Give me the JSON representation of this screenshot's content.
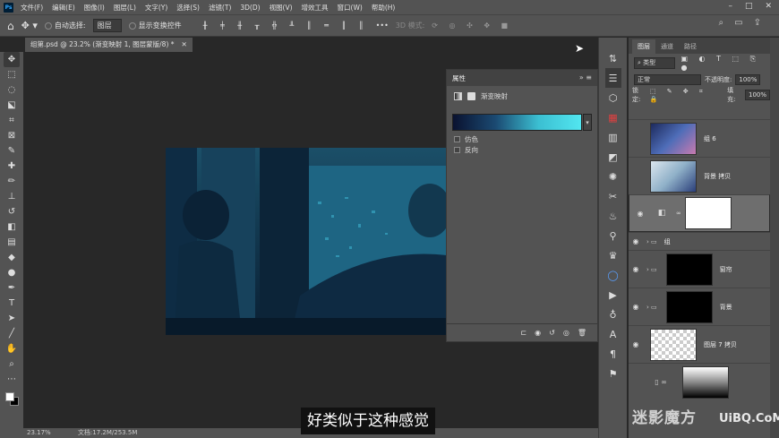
{
  "app": {
    "icon_label": "Ps"
  },
  "menu": [
    "文件(F)",
    "编辑(E)",
    "图像(I)",
    "图层(L)",
    "文字(Y)",
    "选择(S)",
    "滤镜(T)",
    "3D(D)",
    "视图(V)",
    "增效工具",
    "窗口(W)",
    "帮助(H)"
  ],
  "options": {
    "auto_select_label": "自动选择:",
    "auto_select_value": "图层",
    "show_transform_label": "显示变换控件",
    "mode_3d_label": "3D 模式:"
  },
  "document_tab": {
    "title": "组第.psd @ 23.2% (渐变映射 1, 图层蒙版/8) *"
  },
  "status": {
    "zoom": "23.17%",
    "doc_info": "文档:17.2M/253.5M"
  },
  "properties": {
    "title": "属性",
    "subtitle": "渐变映射",
    "options": [
      "仿色",
      "反向"
    ]
  },
  "layers_panel": {
    "tabs": [
      "图层",
      "通道",
      "路径"
    ],
    "filter_label": "类型",
    "blend_mode": "正常",
    "opacity_label": "不透明度:",
    "opacity_value": "100%",
    "lock_label": "锁定:",
    "fill_label": "填充:",
    "fill_value": "100%",
    "layers": [
      {
        "name": "组 6"
      },
      {
        "name": "背景 拷贝"
      },
      {
        "name": ""
      },
      {
        "name": "组"
      },
      {
        "name": "窗帘"
      },
      {
        "name": "背景"
      },
      {
        "name": "图层 7 拷贝"
      },
      {
        "name": ""
      }
    ]
  },
  "subtitle_text": "好类似于这种感觉",
  "watermark": {
    "text1": "迷影魔方",
    "text2": "UiBQ.CoM"
  }
}
